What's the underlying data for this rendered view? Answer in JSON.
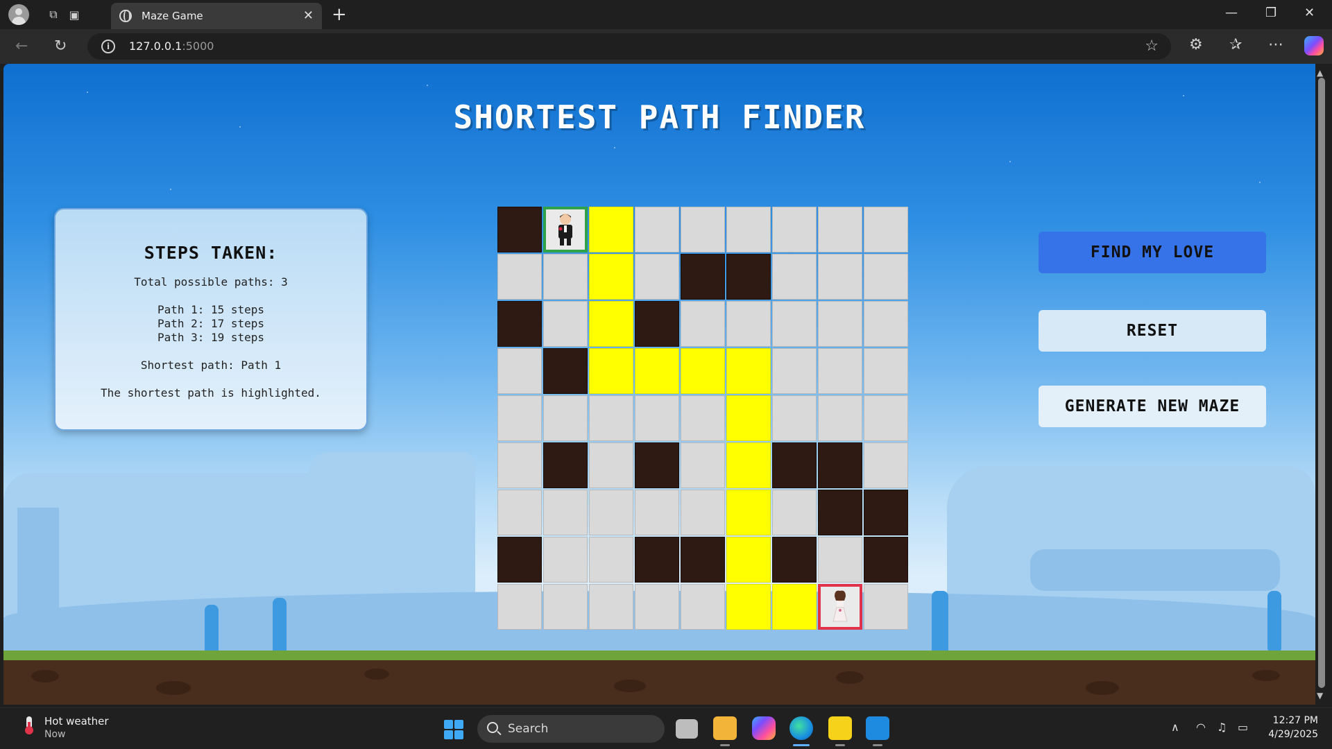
{
  "browser": {
    "tab_title": "Maze Game",
    "url_host": "127.0.0.1",
    "url_port": ":5000"
  },
  "page": {
    "title": "SHORTEST PATH FINDER",
    "steps": {
      "heading": "STEPS TAKEN:",
      "total": "Total possible paths: 3",
      "paths": [
        "Path 1: 15 steps",
        "Path 2: 17 steps",
        "Path 3: 19 steps"
      ],
      "shortest": "Shortest path: Path 1",
      "note": "The shortest path is highlighted."
    },
    "buttons": {
      "find": "FIND MY LOVE",
      "reset": "RESET",
      "generate": "GENERATE NEW MAZE"
    },
    "maze": {
      "legend": {
        "W": "wall",
        "P": "path",
        "S": "start",
        "E": "end",
        ".": "empty"
      },
      "rows": [
        "WSP......",
        "..P.WW...",
        "W.PW.....",
        ".WPPPP...",
        ".....P...",
        ".W.W.PWW.",
        ".....P.WW",
        "W..WWPW.W",
        ".....PPE."
      ],
      "colors": {
        "wall": "#2e1a12",
        "path": "#ffff00",
        "empty": "#d9d9d9",
        "start_border": "#2fa24a",
        "end_border": "#e0334a"
      }
    }
  },
  "taskbar": {
    "weather_title": "Hot weather",
    "weather_sub": "Now",
    "search_placeholder": "Search",
    "time": "12:27 PM",
    "date": "4/29/2025"
  }
}
